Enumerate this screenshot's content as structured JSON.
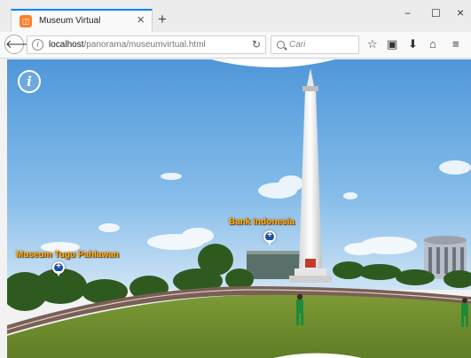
{
  "browser": {
    "tab_title": "Museum Virtual",
    "url_host": "localhost",
    "url_path": "/panorama/museumvirtual.html",
    "search_placeholder": "Cari"
  },
  "icons": {
    "favicon": "firefox-favicon",
    "close": "close-icon",
    "new_tab": "plus-icon",
    "back": "back-arrow-icon",
    "info": "info-icon",
    "reload": "reload-icon",
    "search": "search-icon",
    "bookmark": "star-icon",
    "library": "clipboard-icon",
    "download": "download-icon",
    "home": "home-icon",
    "menu": "hamburger-icon"
  },
  "panorama": {
    "info_button": "i",
    "hotspots": [
      {
        "label": "Bank Indonesia"
      },
      {
        "label": "Museum Tugu Pahlawan"
      }
    ]
  },
  "colors": {
    "tab_accent": "#0a84ff",
    "hotspot_label": "#ffb020",
    "hotspot_pin": "#1d4fa3"
  }
}
